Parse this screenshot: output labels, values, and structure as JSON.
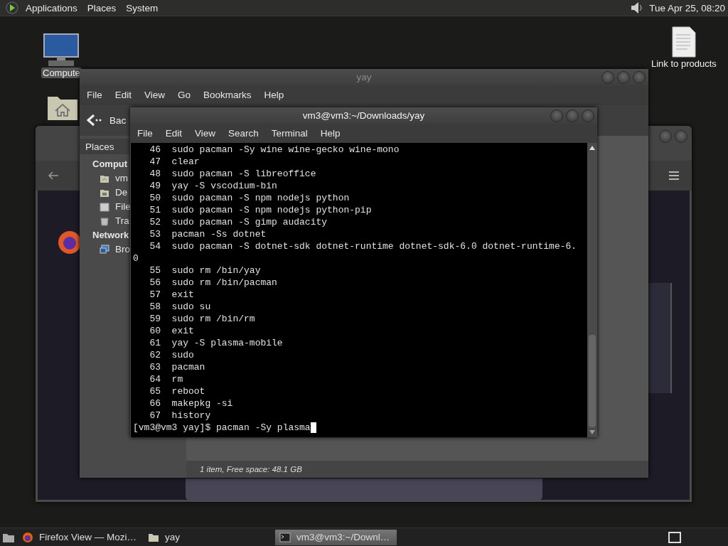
{
  "top_panel": {
    "menus": [
      "Applications",
      "Places",
      "System"
    ],
    "clock": "Tue Apr 25, 08:20"
  },
  "desktop_icons": [
    {
      "kind": "computer",
      "label": "Compute"
    },
    {
      "kind": "home"
    },
    {
      "kind": "document",
      "label": "Link to products"
    }
  ],
  "file_manager": {
    "title": "yay",
    "menu": [
      "File",
      "Edit",
      "View",
      "Go",
      "Bookmarks",
      "Help"
    ],
    "back_button": "Bac",
    "sidebar": {
      "header": "Places",
      "sections": [
        {
          "title": "Comput",
          "items": [
            {
              "kind": "home",
              "label": "vm"
            },
            {
              "kind": "desktop",
              "label": "De"
            },
            {
              "kind": "drive",
              "label": "File"
            },
            {
              "kind": "trash",
              "label": "Tra"
            }
          ]
        },
        {
          "title": "Network",
          "items": [
            {
              "kind": "network",
              "label": "Bro"
            }
          ]
        }
      ]
    },
    "status": "1 item, Free space: 48.1 GB"
  },
  "terminal": {
    "title": "vm3@vm3:~/Downloads/yay",
    "menu": [
      "File",
      "Edit",
      "View",
      "Search",
      "Terminal",
      "Help"
    ],
    "lines": [
      "   46  sudo pacman -Sy wine wine-gecko wine-mono",
      "   47  clear",
      "   48  sudo pacman -S libreoffice",
      "   49  yay -S vscodium-bin",
      "   50  sudo pacman -S npm nodejs python",
      "   51  sudo pacman -S npm nodejs python-pip",
      "   52  sudo pacman -S gimp audacity",
      "   53  pacman -Ss dotnet",
      "   54  sudo pacman -S dotnet-sdk dotnet-runtime dotnet-sdk-6.0 dotnet-runtime-6.",
      "0",
      "   55  sudo rm /bin/yay",
      "   56  sudo rm /bin/pacman",
      "   57  exit",
      "   58  sudo su",
      "   59  sudo rm /bin/rm",
      "   60  exit",
      "   61  yay -S plasma-mobile",
      "   62  sudo",
      "   63  pacman",
      "   64  rm",
      "   65  reboot",
      "   66  makepkg -si",
      "   67  history"
    ],
    "prompt": "[vm3@vm3 yay]$ pacman -Sy plasma"
  },
  "taskbar": {
    "tasks": [
      {
        "kind": "firefox",
        "label": "Firefox View — Mozi…",
        "selected": false
      },
      {
        "kind": "folder",
        "label": "yay",
        "selected": false
      },
      {
        "kind": "terminal",
        "label": "vm3@vm3:~/Downl…",
        "selected": true
      }
    ]
  }
}
